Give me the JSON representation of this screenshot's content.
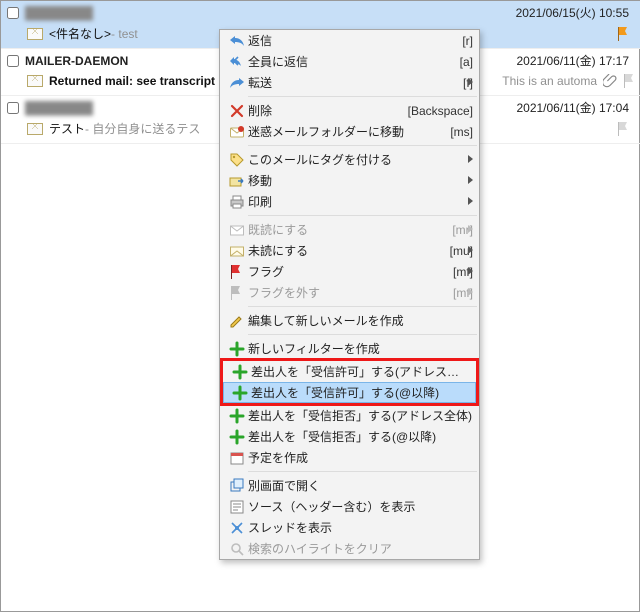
{
  "list": [
    {
      "sender_blurred": true,
      "sender": "",
      "date": "2021/06/15(火) 10:55",
      "subject": "<件名なし>",
      "preview": " - test",
      "selected": true,
      "flag": "orange"
    },
    {
      "sender": "MAILER-DAEMON",
      "date": "2021/06/11(金) 17:17",
      "subject": "Returned mail: see transcript",
      "preview_suffix": "This is an automa",
      "attach": true,
      "flag": "grey",
      "bold": true
    },
    {
      "sender_blurred": true,
      "sender": "",
      "date": "2021/06/11(金) 17:04",
      "subject": "テスト",
      "preview": " - 自分自身に送るテス",
      "flag": "grey"
    }
  ],
  "menu": {
    "items": [
      {
        "icon": "reply",
        "label": "返信",
        "shortcut": "[r]",
        "sub": false
      },
      {
        "icon": "replyall",
        "label": "全員に返信",
        "shortcut": "[a]",
        "sub": false
      },
      {
        "icon": "forward",
        "label": "転送",
        "shortcut": "[f]",
        "sub": true
      },
      {
        "sep": true
      },
      {
        "icon": "delete",
        "label": "削除",
        "shortcut": "[Backspace]",
        "sub": false
      },
      {
        "icon": "spam",
        "label": "迷惑メールフォルダーに移動",
        "shortcut": "[ms]",
        "sub": false
      },
      {
        "sep": true
      },
      {
        "icon": "tag",
        "label": "このメールにタグを付ける",
        "sub": true
      },
      {
        "icon": "move",
        "label": "移動",
        "sub": true
      },
      {
        "icon": "print",
        "label": "印刷",
        "sub": true
      },
      {
        "sep": true
      },
      {
        "icon": "read",
        "label": "既読にする",
        "shortcut": "[mr]",
        "sub": true,
        "disabled": true
      },
      {
        "icon": "unread",
        "label": "未読にする",
        "shortcut": "[mu]",
        "sub": true
      },
      {
        "icon": "flag",
        "label": "フラグ",
        "shortcut": "[mf]",
        "sub": true
      },
      {
        "icon": "unflag",
        "label": "フラグを外す",
        "shortcut": "[mf]",
        "sub": true,
        "disabled": true
      },
      {
        "sep": true
      },
      {
        "icon": "edit",
        "label": "編集して新しいメールを作成",
        "sub": false
      },
      {
        "sep": true
      },
      {
        "icon": "plus",
        "label": "新しいフィルターを作成",
        "sub": false
      },
      {
        "group": "redbox",
        "items": [
          {
            "icon": "plus",
            "label": "差出人を「受信許可」する(アドレス全体)"
          },
          {
            "icon": "plus",
            "label": "差出人を「受信許可」する(@以降)",
            "highlight": true
          }
        ]
      },
      {
        "icon": "plus",
        "label": "差出人を「受信拒否」する(アドレス全体)"
      },
      {
        "icon": "plus",
        "label": "差出人を「受信拒否」する(@以降)"
      },
      {
        "icon": "cal",
        "label": "予定を作成"
      },
      {
        "sep": true
      },
      {
        "icon": "popout",
        "label": "別画面で開く"
      },
      {
        "icon": "source",
        "label": "ソース（ヘッダー含む）を表示"
      },
      {
        "icon": "thread",
        "label": "スレッドを表示"
      },
      {
        "icon": "search",
        "label": "検索のハイライトをクリア",
        "disabled": true
      }
    ]
  }
}
